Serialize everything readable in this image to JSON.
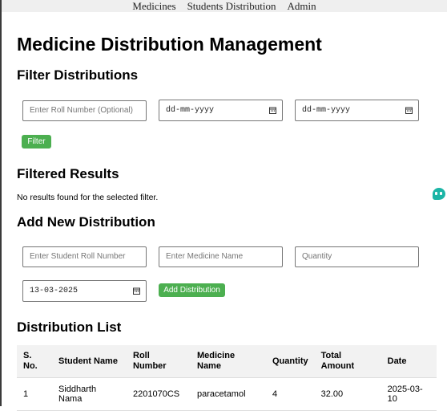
{
  "nav": {
    "items": [
      "Medicines",
      "Students Distribution",
      "Admin"
    ]
  },
  "page": {
    "title": "Medicine Distribution Management"
  },
  "filter": {
    "heading": "Filter Distributions",
    "roll_placeholder": "Enter Roll Number (Optional)",
    "start_date": "dd-mm-yyyy",
    "end_date": "dd-mm-yyyy",
    "button": "Filter"
  },
  "results": {
    "heading": "Filtered Results",
    "message": "No results found for the selected filter."
  },
  "add": {
    "heading": "Add New Distribution",
    "roll_placeholder": "Enter Student Roll Number",
    "medicine_placeholder": "Enter Medicine Name",
    "quantity_placeholder": "Quantity",
    "date_value": "13-03-2025",
    "button": "Add Distribution"
  },
  "list": {
    "heading": "Distribution List",
    "columns": [
      "S. No.",
      "Student Name",
      "Roll Number",
      "Medicine Name",
      "Quantity",
      "Total Amount",
      "Date"
    ],
    "rows": [
      [
        "1",
        "Siddharth Nama",
        "2201070CS",
        "paracetamol",
        "4",
        "32.00",
        "2025-03-10"
      ]
    ]
  },
  "icons": {
    "calendar": "calendar-icon",
    "chat": "chat-icon"
  },
  "colors": {
    "accent": "#4caf50",
    "chat": "#1cb5a6"
  }
}
